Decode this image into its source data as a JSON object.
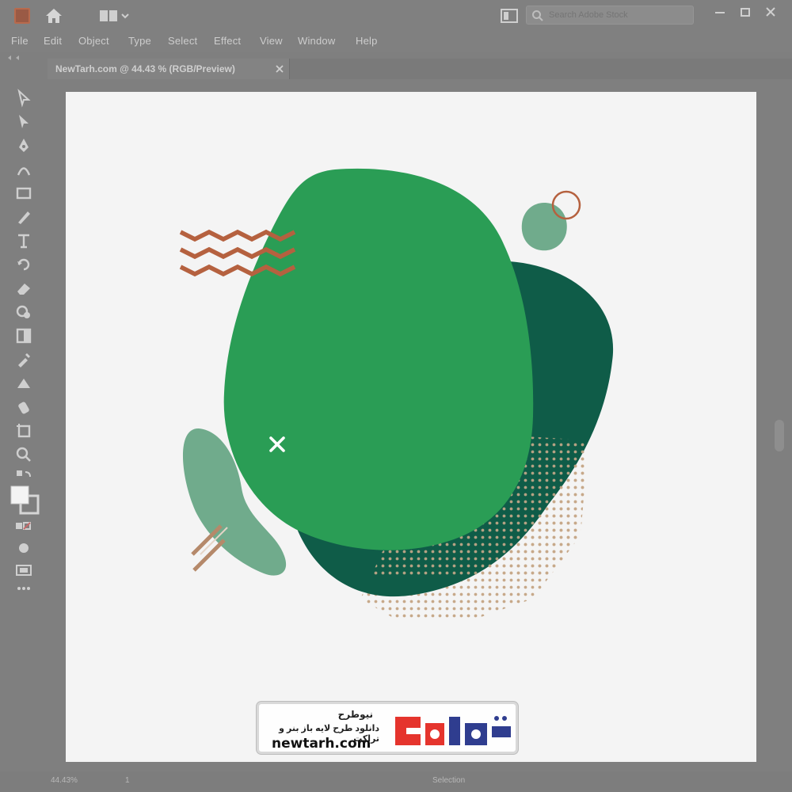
{
  "app": {
    "search_placeholder": "Search Adobe Stock"
  },
  "menu": [
    "File",
    "Edit",
    "Object",
    "Type",
    "Select",
    "Effect",
    "View",
    "Window",
    "Help"
  ],
  "document": {
    "tab_title": "NewTarh.com @ 44.43 % (RGB/Preview)"
  },
  "status": {
    "zoom": "44.43%",
    "artboard": "1",
    "tool": "Selection"
  },
  "watermark": {
    "brand_fa": "نیوطرح",
    "tagline_fa": "دانلود طرح لایه باز بنر و تراکت",
    "domain": "newtarh.com",
    "logo_text": "نیوطرح"
  },
  "colors": {
    "main_blob": "#2a9d55",
    "dark_blob": "#0f5c48",
    "soft_blob": "#70ab8c",
    "accent": "#b5613f",
    "dots": "#c7a98a",
    "logo_red": "#e5342d",
    "logo_blue": "#2f3d8f"
  }
}
